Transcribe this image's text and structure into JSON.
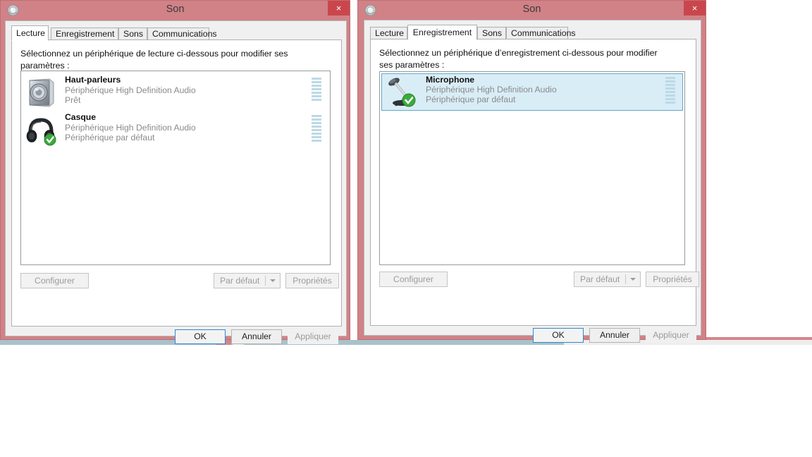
{
  "windows": [
    {
      "title": "Son",
      "close_label": "×",
      "window_icon": "sound-settings-icon",
      "tabs": [
        {
          "label": "Lecture",
          "active": true
        },
        {
          "label": "Enregistrement",
          "active": false
        },
        {
          "label": "Sons",
          "active": false
        },
        {
          "label": "Communications",
          "active": false
        }
      ],
      "caption": "Sélectionnez un périphérique de lecture ci-dessous pour modifier ses paramètres :",
      "devices": [
        {
          "name": "Haut-parleurs",
          "driver": "Périphérique High Definition Audio",
          "status": "Prêt",
          "icon": "speaker-icon",
          "default": false,
          "selected": false,
          "meter_level": 7
        },
        {
          "name": "Casque",
          "driver": "Périphérique High Definition Audio",
          "status": "Périphérique par défaut",
          "icon": "headphones-icon",
          "default": true,
          "selected": false,
          "meter_level": 8
        }
      ],
      "buttons": {
        "configure": "Configurer",
        "set_default": "Par défaut",
        "properties": "Propriétés",
        "ok": "OK",
        "cancel": "Annuler",
        "apply": "Appliquer"
      }
    },
    {
      "title": "Son",
      "close_label": "×",
      "window_icon": "sound-settings-icon",
      "tabs": [
        {
          "label": "Lecture",
          "active": false
        },
        {
          "label": "Enregistrement",
          "active": true
        },
        {
          "label": "Sons",
          "active": false
        },
        {
          "label": "Communications",
          "active": false
        }
      ],
      "caption": "Sélectionnez un périphérique d’enregistrement ci-dessous pour modifier ses paramètres :",
      "devices": [
        {
          "name": "Microphone",
          "driver": "Périphérique High Definition Audio",
          "status": "Périphérique par défaut",
          "icon": "microphone-icon",
          "default": true,
          "selected": true,
          "meter_level": 8
        }
      ],
      "buttons": {
        "configure": "Configurer",
        "set_default": "Par défaut",
        "properties": "Propriétés",
        "ok": "OK",
        "cancel": "Annuler",
        "apply": "Appliquer"
      }
    }
  ],
  "colors": {
    "window_frame": "#d08287",
    "close_button": "#c9474c",
    "selection": "#d9edf7",
    "selection_border": "#5fa8c8",
    "meter_bar": "#bcd9e6",
    "default_badge": "#3caa3c",
    "focus_border": "#2f8ad1"
  }
}
